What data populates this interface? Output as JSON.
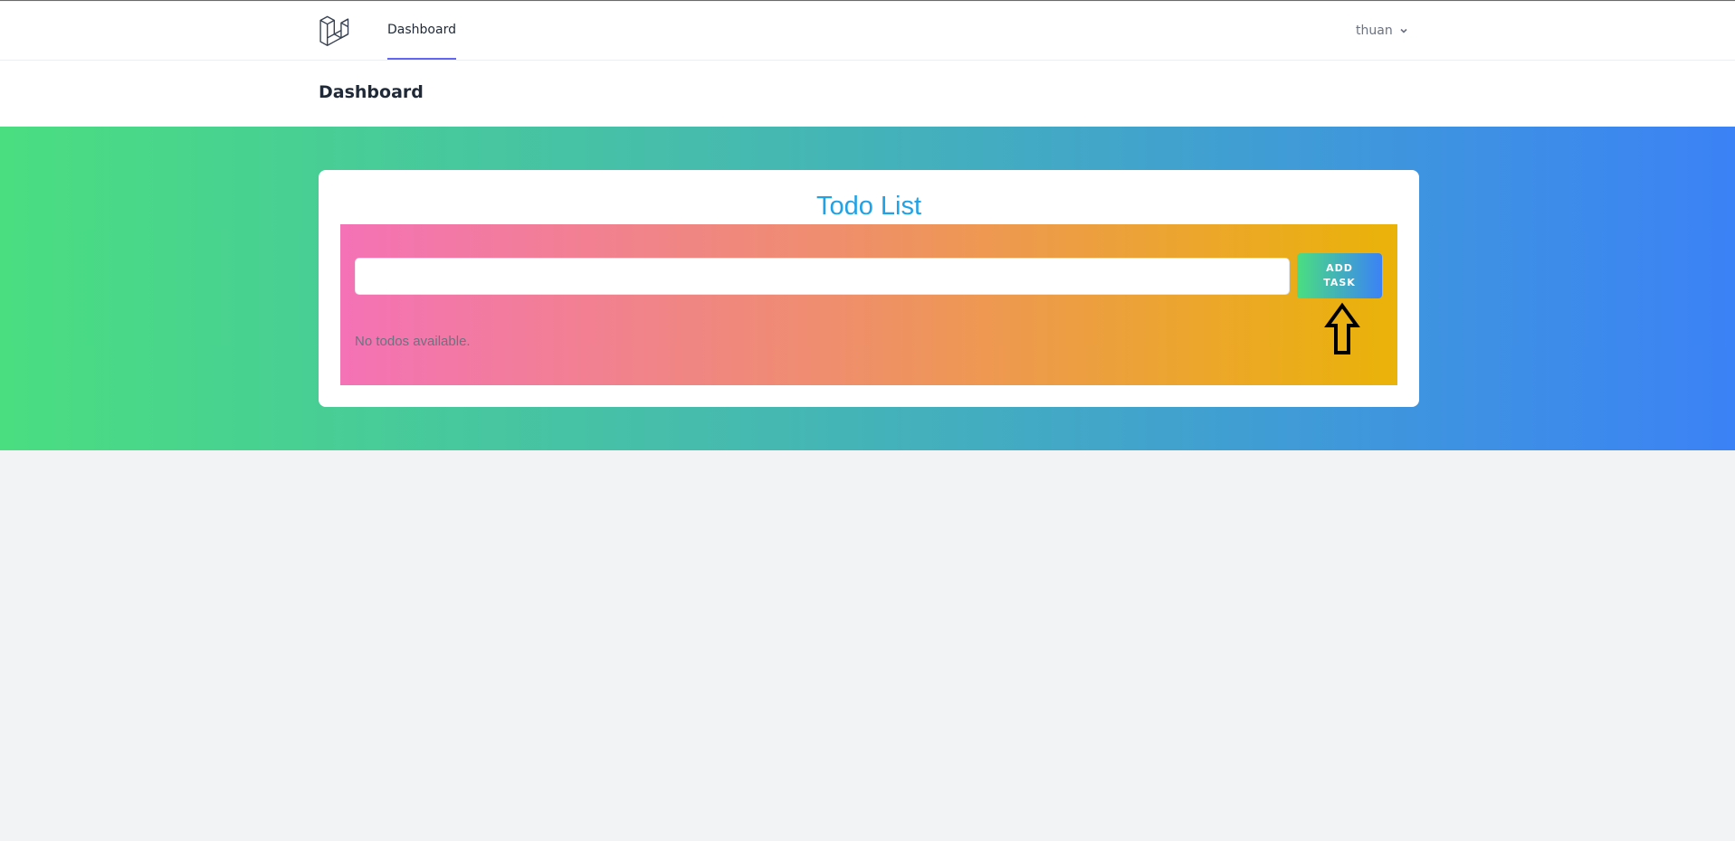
{
  "nav": {
    "logo_icon": "laravel-logo-icon",
    "dashboard_link": "Dashboard",
    "user_name": "thuan",
    "user_menu_icon": "chevron-down-icon"
  },
  "header": {
    "title": "Dashboard"
  },
  "todo": {
    "title": "Todo List",
    "input_value": "",
    "add_button_label": "ADD TASK",
    "empty_message": "No todos available.",
    "annotation_icon": "up-arrow-icon"
  },
  "colors": {
    "accent": "#6366f1",
    "title_blue": "#1fa2e6",
    "hero_gradient": [
      "#4ade80",
      "#3b82f6"
    ],
    "panel_gradient": [
      "#f472b6",
      "#eab308"
    ]
  }
}
